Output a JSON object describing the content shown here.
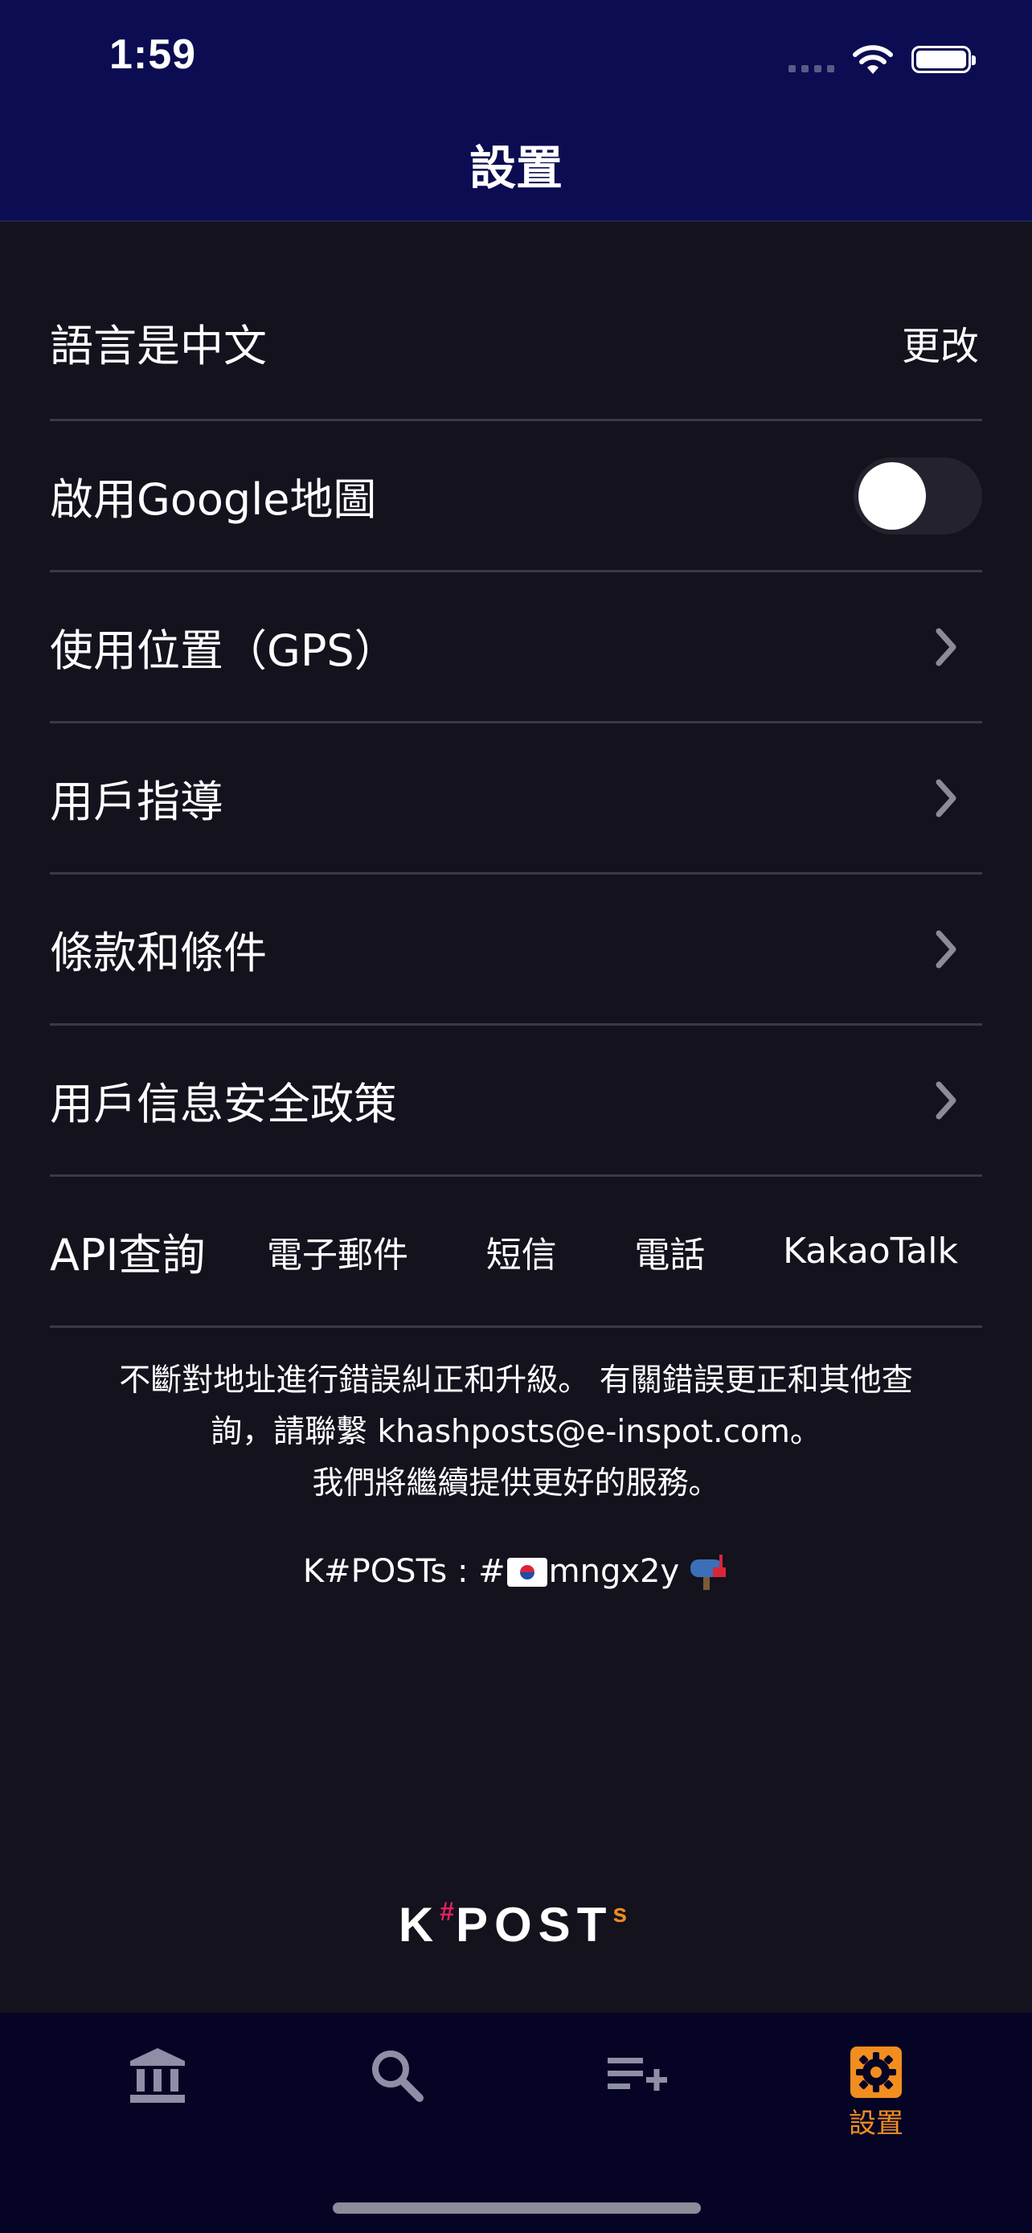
{
  "status_bar": {
    "time": "1:59"
  },
  "nav": {
    "title": "設置"
  },
  "settings": {
    "language": {
      "label": "語言是中文",
      "action": "更改"
    },
    "google_maps": {
      "label": "啟用Google地圖",
      "enabled": false
    },
    "gps": {
      "label": "使用位置（GPS）"
    },
    "user_guide": {
      "label": "用戶指導"
    },
    "terms": {
      "label": "條款和條件"
    },
    "privacy": {
      "label": "用戶信息安全政策"
    },
    "api": {
      "label": "API查詢",
      "links": [
        "電子郵件",
        "短信",
        "電話",
        "KakaoTalk"
      ]
    }
  },
  "footer": {
    "line1": "不斷對地址進行錯誤糾正和升級。 有關錯誤更正和其他查",
    "line2": "詢，請聯繫 khashposts@e-inspot.com。",
    "line3": "我們將繼續提供更好的服務。",
    "kpost_prefix": "K#POSTs : #",
    "kpost_code": "mngx2y"
  },
  "brand": {
    "k": "K",
    "hash": "#",
    "post": "POST",
    "s": "s"
  },
  "tab_bar": {
    "active_tab": "settings",
    "settings_label": "設置",
    "active_color": "#f28d1f",
    "inactive_color": "#8e8ea6"
  }
}
